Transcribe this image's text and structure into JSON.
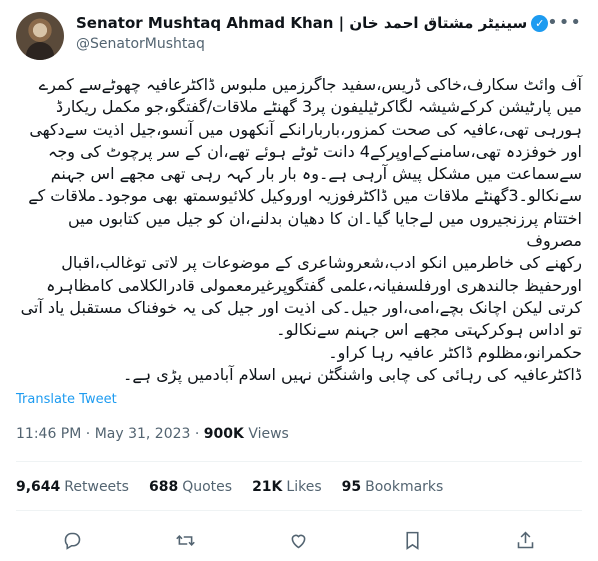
{
  "author": {
    "display_name": "Senator Mushtaq Ahmad Khan | سینیٹر مشتاق احمد خان",
    "handle": "@SenatorMushtaq",
    "verified_color": "#1d9bf0"
  },
  "tweet": {
    "text": "آف وائٹ سکارف،خاکی ڈریس،سفید جاگرزمیں ملبوس ڈاکٹرعافیہ چھوٹےسے کمرے\nمیں پارٹیشن کرکےشیشہ لگاکرٹیلیفون پر3 گھنٹے ملاقات/گفتگو،جو مکمل ریکارڈ\nہورہی تھی،عافیہ کی صحت کمزور،باربارانکے آنکھوں میں آنسو،جیل اذیت سےدکھی\nاور خوفزدہ تھی،سامنےکےاوپرکے4 دانت ٹوٹے ہوئے تھے،ان کے سر پرچوٹ کی وجہ\nسےسماعت میں مشکل پیش آرہی ہے۔وہ بار بار کہہ رہی تھی مجھے اس جہنم\nسےنکالو۔3گھنٹے ملاقات میں ڈاکٹرفوزیہ اوروکیل کلائیوسمتھ بھی موجود۔ملاقات کے\nاختتام پرزنجیروں میں لےجایا گیا۔ان کا دھیان بدلنے،ان کو جیل میں کتابوں میں مصروف\nرکھنے کی خاطرمیں انکو ادب،شعروشاعری کے موضوعات پر لاتی توغالب،اقبال\nاورحفیظ جالندھری اورفلسفیانہ،علمی گفتگوپرغیرمعمولی قادرالکلامی کامظاہرہ\nکرتی لیکن اچانک بچے،امی،اور جیل۔کی اذیت اور جیل کی یہ خوفناک مستقبل یاد آتی\nتو اداس ہوکرکہتی مجھے اس جہنم سےنکالو۔\nحکمرانو،مظلوم ڈاکٹر عافیہ رہا کراو۔\nڈاکٹرعافیہ کی رہائی کی چابی واشنگٹن نہیں اسلام آبادمیں پڑی ہے۔"
  },
  "translate_label": "Translate Tweet",
  "meta": {
    "time": "11:46 PM",
    "separator": "·",
    "date": "May 31, 2023",
    "views_count": "900K",
    "views_label": "Views"
  },
  "stats": {
    "retweets_count": "9,644",
    "retweets_label": "Retweets",
    "quotes_count": "688",
    "quotes_label": "Quotes",
    "likes_count": "21K",
    "likes_label": "Likes",
    "bookmarks_count": "95",
    "bookmarks_label": "Bookmarks"
  },
  "icons": {
    "more": "more-icon",
    "reply": "reply-icon",
    "retweet": "retweet-icon",
    "like": "like-icon",
    "bookmark": "bookmark-icon",
    "share": "share-icon"
  },
  "colors": {
    "text": "#0f1419",
    "secondary": "#536471",
    "link": "#1d9bf0",
    "divider": "#eff3f4"
  }
}
